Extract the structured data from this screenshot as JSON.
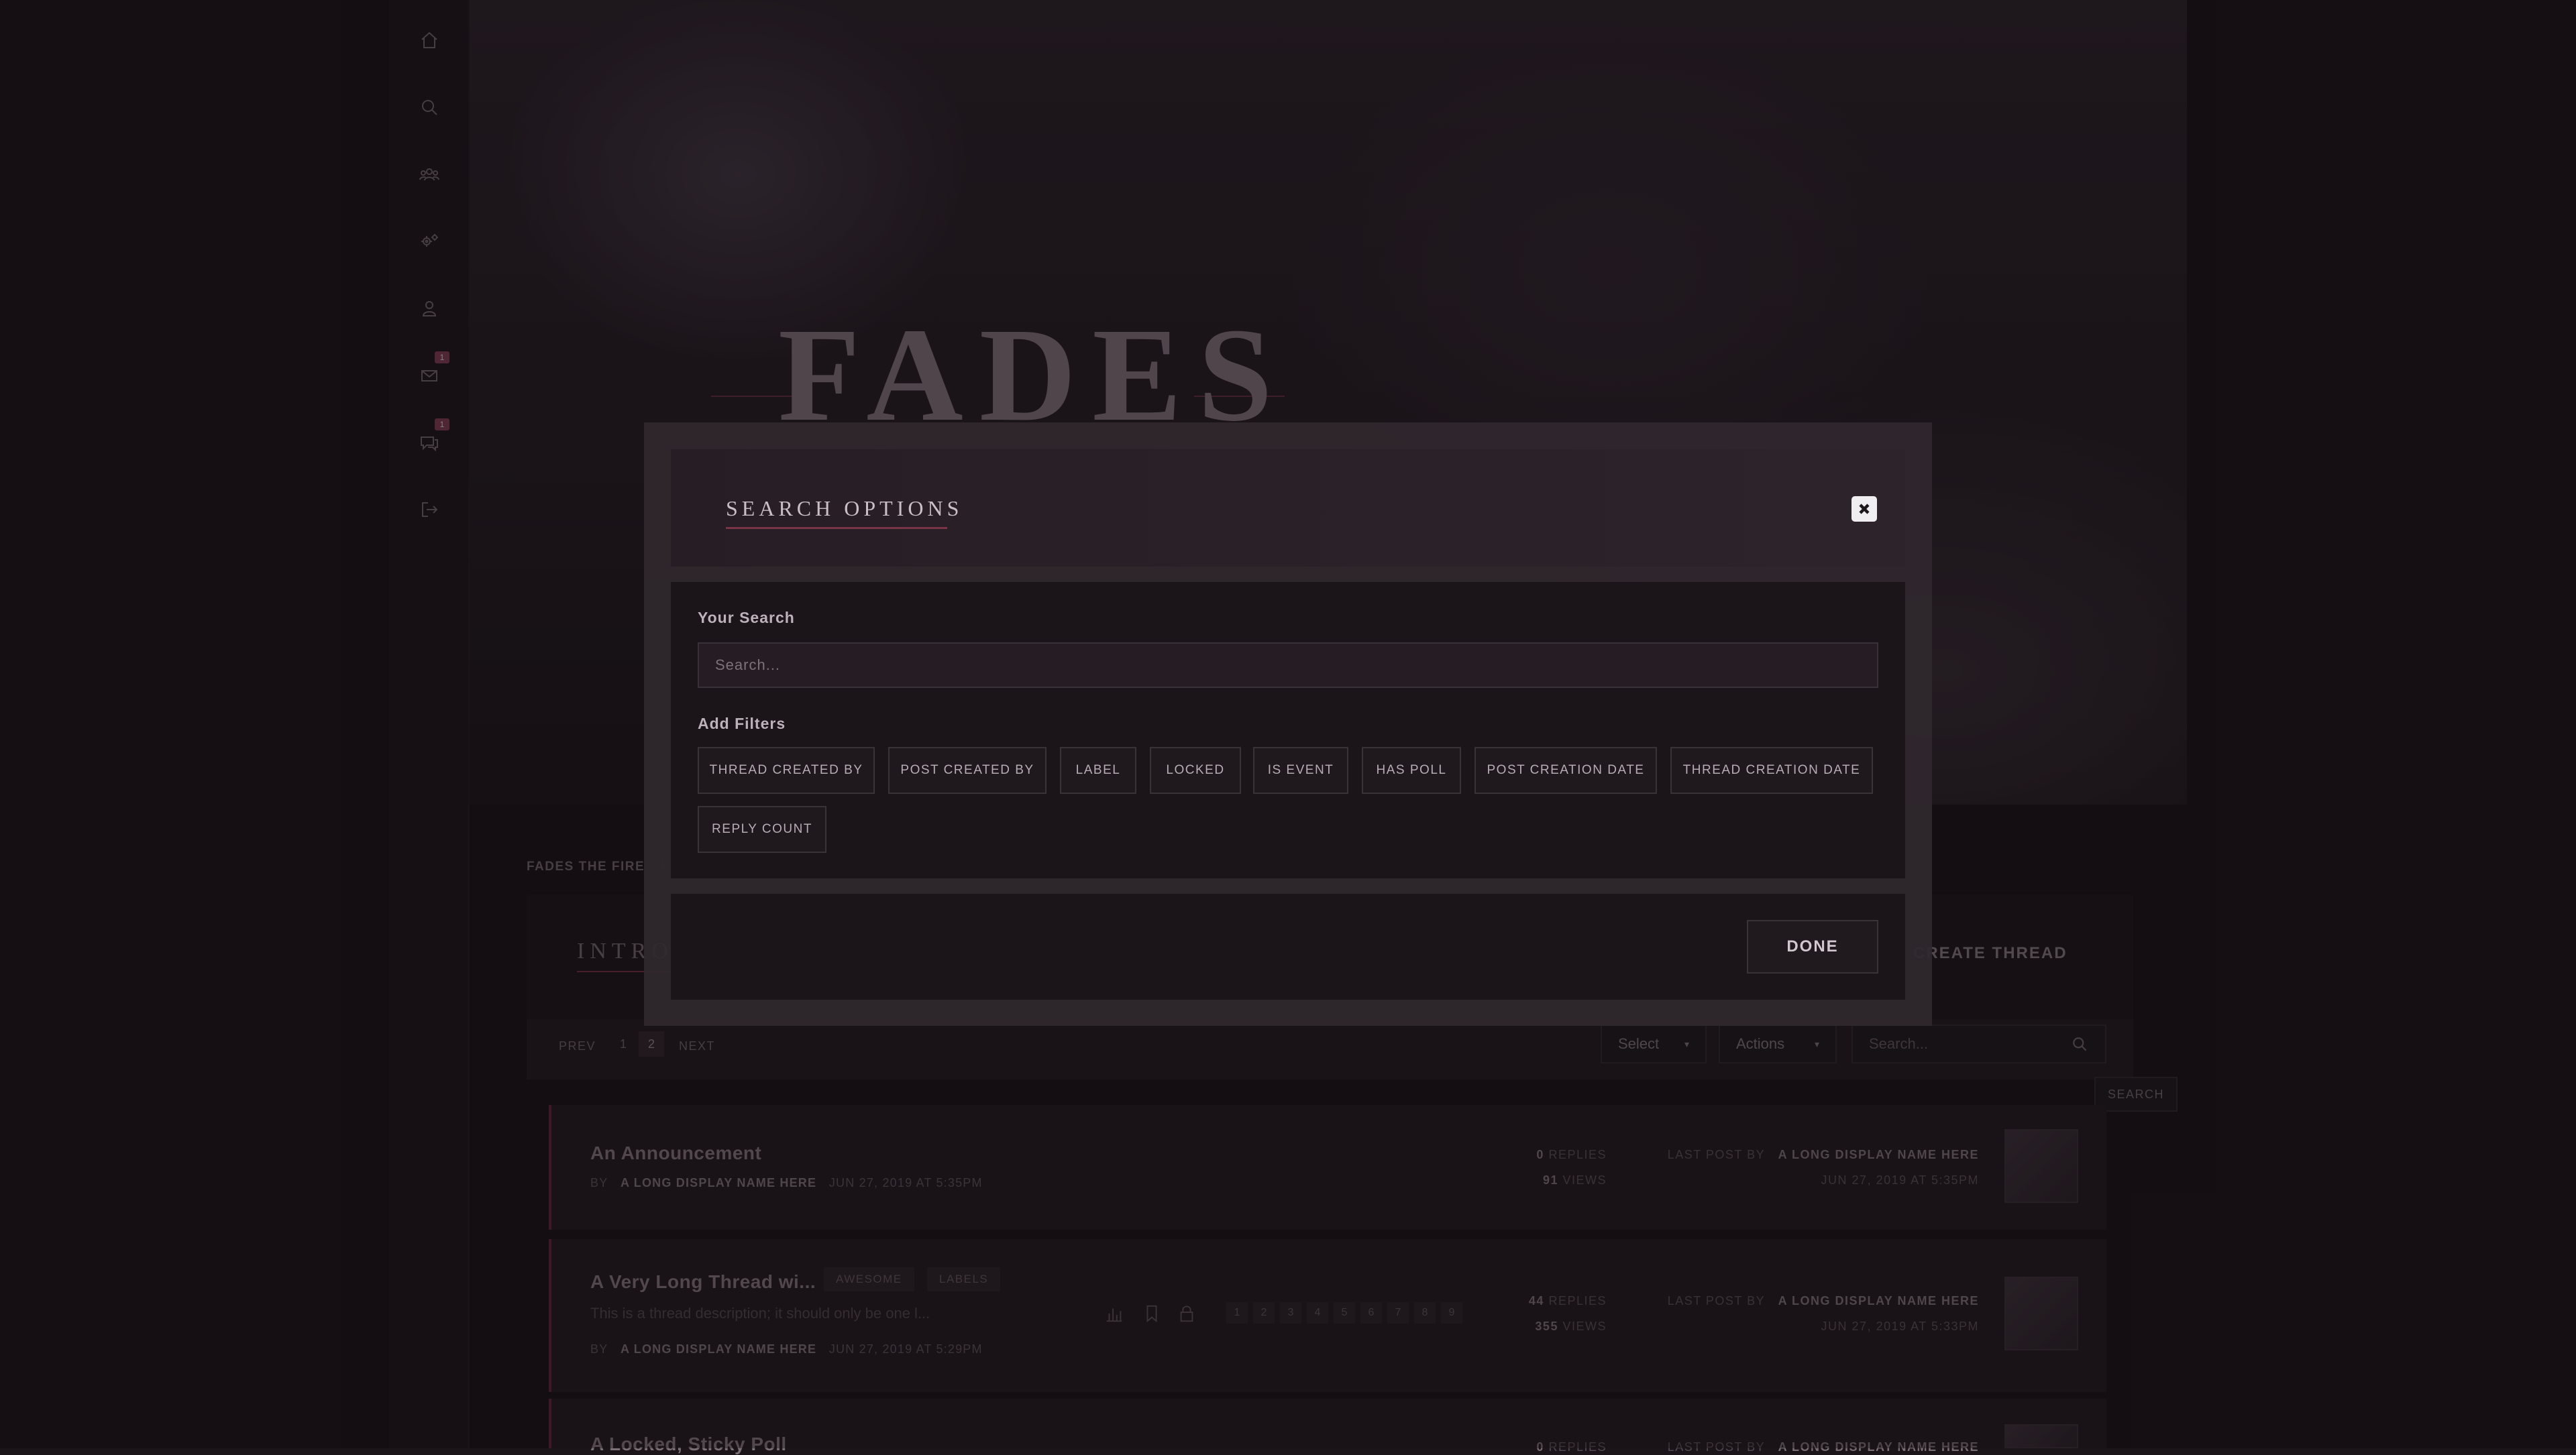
{
  "sidebar": {
    "items": [
      {
        "name": "home",
        "icon": "home-icon"
      },
      {
        "name": "search",
        "icon": "search-icon"
      },
      {
        "name": "members",
        "icon": "users-icon"
      },
      {
        "name": "settings",
        "icon": "gears-icon"
      },
      {
        "name": "profile",
        "icon": "user-icon"
      },
      {
        "name": "messages",
        "icon": "envelope-icon",
        "badge": "1"
      },
      {
        "name": "conversations",
        "icon": "chat-icon",
        "badge": "1"
      },
      {
        "name": "logout",
        "icon": "logout-icon"
      }
    ]
  },
  "banner": {
    "title": "FADES"
  },
  "breadcrumb": {
    "root": "FADES THE FIRE",
    "separator": "/"
  },
  "forum": {
    "title": "INTROD",
    "create_thread": "CREATE THREAD",
    "pagination": {
      "prev": "PREV",
      "pages": [
        "1",
        "2"
      ],
      "active": "2",
      "next": "NEXT"
    },
    "select_label": "Select",
    "actions_label": "Actions",
    "search_placeholder": "Search...",
    "search_button": "SEARCH"
  },
  "threads": [
    {
      "title": "An Announcement",
      "by_label": "BY",
      "author": "A LONG DISPLAY NAME HERE",
      "date": "JUN 27, 2019 AT 5:35PM",
      "replies": "0",
      "replies_label": "REPLIES",
      "views": "91",
      "views_label": "VIEWS",
      "last_post_label": "LAST POST BY",
      "last_author": "A LONG DISPLAY NAME HERE",
      "last_date": "JUN 27, 2019 AT 5:35PM"
    },
    {
      "title": "A Very Long Thread wi...",
      "tags": [
        "AWESOME",
        "LABELS"
      ],
      "description": "This is a thread description; it should only be one l...",
      "pages": [
        "1",
        "2",
        "3",
        "4",
        "5",
        "6",
        "7",
        "8",
        "9"
      ],
      "by_label": "BY",
      "author": "A LONG DISPLAY NAME HERE",
      "date": "JUN 27, 2019 AT 5:29PM",
      "replies": "44",
      "replies_label": "REPLIES",
      "views": "355",
      "views_label": "VIEWS",
      "last_post_label": "LAST POST BY",
      "last_author": "A LONG DISPLAY NAME HERE",
      "last_date": "JUN 27, 2019 AT 5:33PM"
    },
    {
      "title": "A Locked, Sticky Poll",
      "replies": "0",
      "replies_label": "REPLIES",
      "last_post_label": "LAST POST BY",
      "last_author": "A LONG DISPLAY NAME HERE"
    }
  ],
  "modal": {
    "title": "SEARCH OPTIONS",
    "your_search_label": "Your Search",
    "search_placeholder": "Search...",
    "add_filters_label": "Add Filters",
    "filters": [
      "THREAD CREATED BY",
      "POST CREATED BY",
      "LABEL",
      "LOCKED",
      "IS EVENT",
      "HAS POLL",
      "POST CREATION DATE",
      "THREAD CREATION DATE",
      "REPLY COUNT"
    ],
    "done_label": "DONE"
  },
  "colors": {
    "accent": "#7a3448",
    "background": "#1b1419",
    "modal_body": "#1b1418"
  }
}
